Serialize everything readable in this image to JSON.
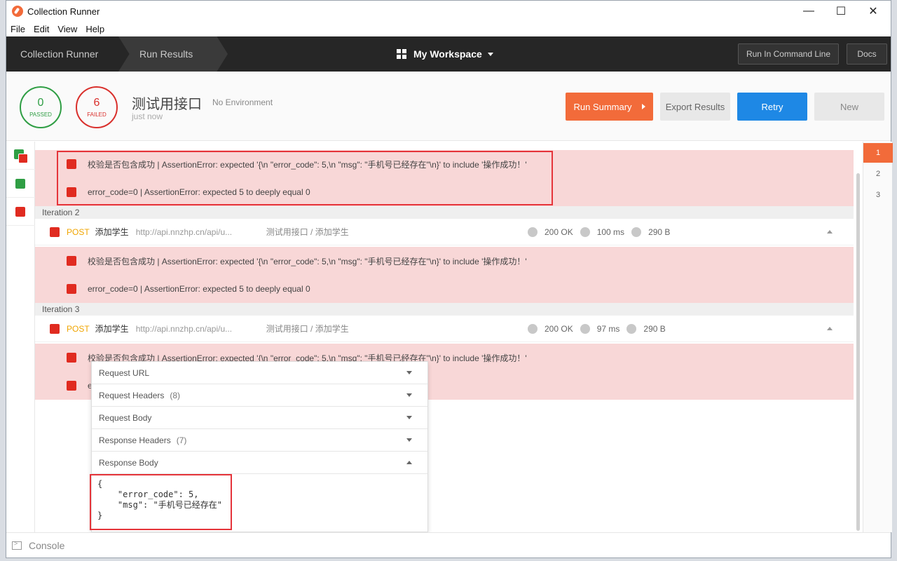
{
  "window": {
    "title": "Collection Runner",
    "controls": [
      "—",
      "☐",
      "✕"
    ]
  },
  "menu": [
    "File",
    "Edit",
    "View",
    "Help"
  ],
  "nav": {
    "crumb1": "Collection Runner",
    "crumb2": "Run Results",
    "workspace": "My Workspace",
    "cmdline": "Run In Command Line",
    "docs": "Docs"
  },
  "summary": {
    "passed_count": "0",
    "passed_label": "PASSED",
    "failed_count": "6",
    "failed_label": "FAILED",
    "collection": "测试用接口",
    "environment": "No Environment",
    "when": "just now",
    "btn_summary": "Run Summary",
    "btn_export": "Export Results",
    "btn_retry": "Retry",
    "btn_new": "New"
  },
  "tests": {
    "t1": "校验是否包含成功 | AssertionError: expected '{\\n \"error_code\": 5,\\n \"msg\": \"手机号已经存在\"\\n}' to include '操作成功！'",
    "t2": "error_code=0 | AssertionError: expected 5 to deeply equal 0",
    "t3_partial": "校验是否包含成功 | AssertionError: expected '{\\n \"error_code\": 5,\\n \"msg\": \"手机号已经存在\"\\n}' to include '操作成功！'",
    "t4_partial": "e"
  },
  "iterations": [
    {
      "label": "Iteration 2",
      "method": "POST",
      "name": "添加学生",
      "url": "http://api.nnzhp.cn/api/u...",
      "path": "测试用接口 / 添加学生",
      "status": "200 OK",
      "time": "100 ms",
      "size": "290 B"
    },
    {
      "label": "Iteration 3",
      "method": "POST",
      "name": "添加学生",
      "url": "http://api.nnzhp.cn/api/u...",
      "path": "测试用接口 / 添加学生",
      "status": "200 OK",
      "time": "97 ms",
      "size": "290 B"
    }
  ],
  "pages": [
    "1",
    "2",
    "3"
  ],
  "details": {
    "request_url": "Request URL",
    "request_headers": "Request Headers",
    "request_headers_count": "(8)",
    "request_body": "Request Body",
    "response_headers": "Response Headers",
    "response_headers_count": "(7)",
    "response_body": "Response Body",
    "body_code": "{\n    \"error_code\": 5,\n    \"msg\": \"手机号已经存在\"\n}"
  },
  "footer": {
    "console": "Console"
  },
  "colors": {
    "accent": "#f26b3a",
    "retry": "#1e88e5",
    "pass": "#2f9e44",
    "fail": "#d9302c",
    "fail_bg": "#f8d7d7"
  }
}
